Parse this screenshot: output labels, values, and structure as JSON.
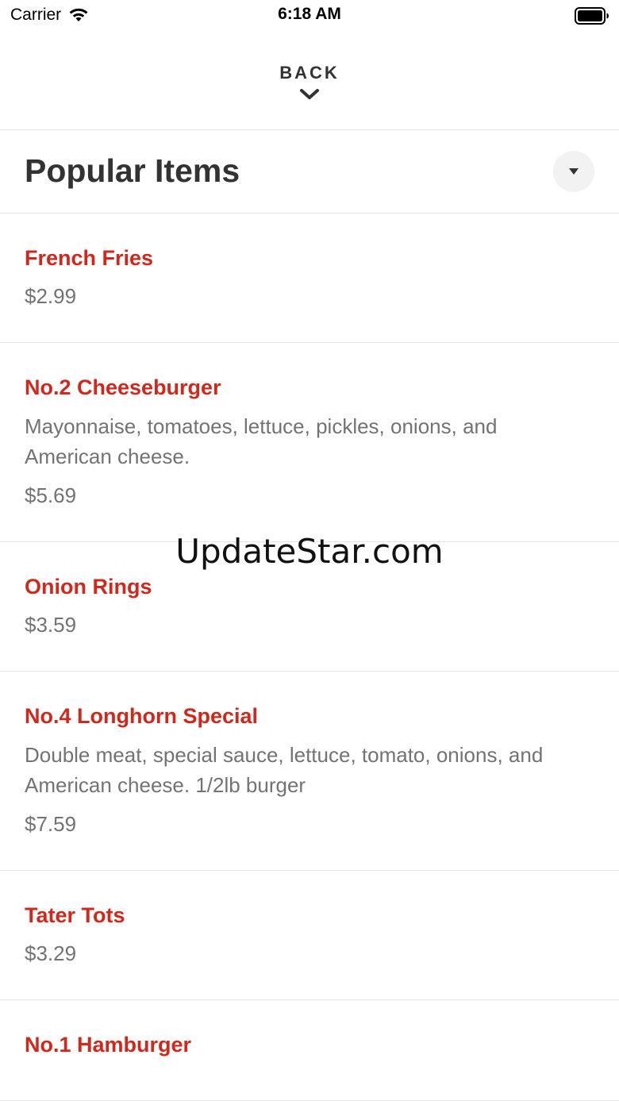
{
  "status_bar": {
    "carrier": "Carrier",
    "time": "6:18 AM",
    "icons": [
      "wifi-icon",
      "battery-icon"
    ]
  },
  "navigation": {
    "back_label": "BACK",
    "back_icon": "chevron-down-icon"
  },
  "section": {
    "title": "Popular Items",
    "toggle_icon": "caret-down-icon"
  },
  "items": [
    {
      "name": "French Fries",
      "description": "",
      "price": "$2.99"
    },
    {
      "name": "No.2 Cheeseburger",
      "description": "Mayonnaise, tomatoes, lettuce, pickles, onions, and American cheese.",
      "price": "$5.69"
    },
    {
      "name": "Onion Rings",
      "description": "",
      "price": "$3.59"
    },
    {
      "name": "No.4 Longhorn Special",
      "description": "Double meat, special sauce, lettuce, tomato, onions, and American cheese. 1/2lb burger",
      "price": "$7.59"
    },
    {
      "name": "Tater Tots",
      "description": "",
      "price": "$3.29"
    },
    {
      "name": "No.1 Hamburger",
      "description": "",
      "price": ""
    }
  ],
  "watermark": "UpdateStar.com",
  "colors": {
    "accent": "#d2271b",
    "text": "#333333",
    "muted": "#737373",
    "divider": "#e6e6e6"
  }
}
